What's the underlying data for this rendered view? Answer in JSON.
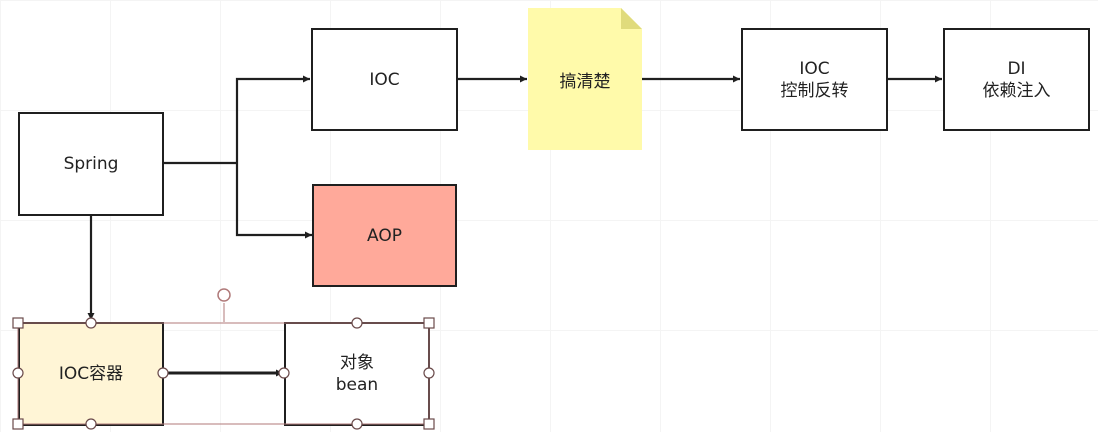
{
  "diagram": {
    "nodes": {
      "spring": {
        "label": "Spring"
      },
      "ioc": {
        "label": "IOC"
      },
      "aop": {
        "label": "AOP",
        "fill": "#ffa99a"
      },
      "note": {
        "label": "搞清楚",
        "fill": "#fffaaa"
      },
      "ioc_inversion": {
        "line1": "IOC",
        "line2": "控制反转"
      },
      "di": {
        "line1": "DI",
        "line2": "依赖注入"
      },
      "ioc_container": {
        "label": "IOC容器",
        "fill": "#fff5d6"
      },
      "bean": {
        "line1": "对象",
        "line2": "bean"
      }
    },
    "edges": [
      {
        "from": "Spring",
        "to": "IOC"
      },
      {
        "from": "Spring",
        "to": "AOP"
      },
      {
        "from": "Spring",
        "to": "IOC容器"
      },
      {
        "from": "IOC",
        "to": "搞清楚"
      },
      {
        "from": "搞清楚",
        "to": "IOC 控制反转"
      },
      {
        "from": "IOC 控制反转",
        "to": "DI 依赖注入"
      },
      {
        "from": "IOC容器",
        "to": "对象 bean"
      }
    ],
    "selection_color": "#b07a7a"
  }
}
